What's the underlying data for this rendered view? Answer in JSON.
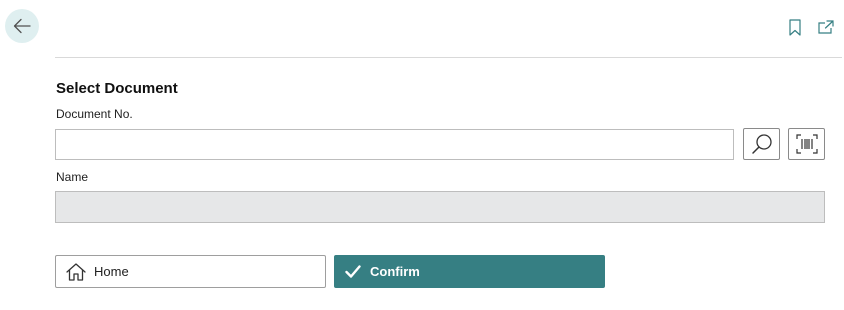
{
  "header": {
    "back_icon": "arrow-left-icon",
    "bookmark_icon": "bookmark-icon",
    "open_new_window_icon": "open-in-new-window-icon"
  },
  "form": {
    "title": "Select Document",
    "document_no": {
      "label": "Document No.",
      "value": "",
      "search_icon": "search-icon",
      "scan_icon": "barcode-scan-icon"
    },
    "name": {
      "label": "Name",
      "value": ""
    }
  },
  "actions": {
    "home_label": "Home",
    "home_icon": "home-icon",
    "confirm_label": "Confirm",
    "confirm_icon": "checkmark-icon"
  },
  "colors": {
    "accent": "#367f83",
    "back_button_bg": "#dfeff0",
    "disabled_field_bg": "#e6e7e8"
  }
}
